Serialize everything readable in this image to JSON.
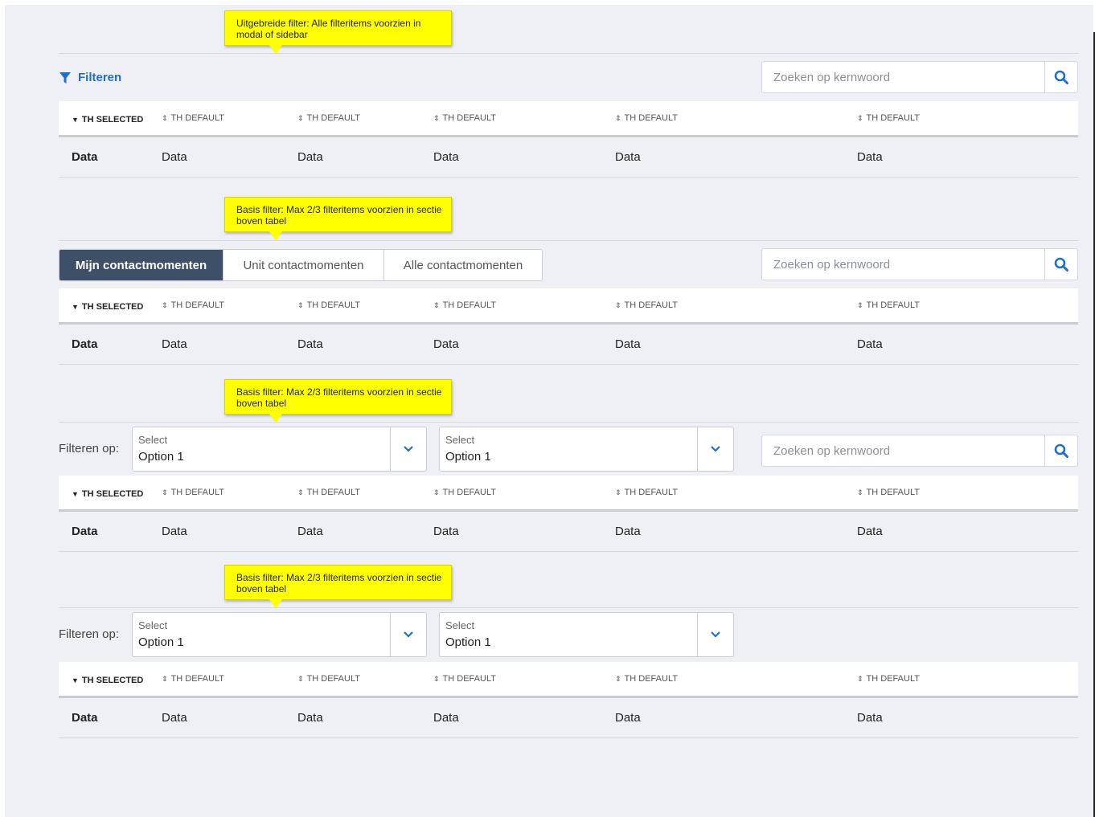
{
  "tooltips": {
    "extended": "Uitgebreide filter: Alle filteritems voorzien in modal of sidebar",
    "basic1": "Basis filter: Max 2/3 filteritems voorzien in sectie boven tabel",
    "basic2": "Basis filter: Max 2/3 filteritems voorzien in sectie boven tabel",
    "basic3": "Basis filter: Max 2/3 filteritems voorzien in sectie boven tabel"
  },
  "filter_link": {
    "label": "Filteren",
    "icon": "funnel-icon"
  },
  "search": {
    "placeholder": "Zoeken op kernwoord",
    "icon": "search-icon"
  },
  "table": {
    "headers": [
      "TH SELECTED",
      "TH DEFAULT",
      "TH DEFAULT",
      "TH DEFAULT",
      "TH DEFAULT",
      "TH DEFAULT"
    ],
    "row": [
      "Data",
      "Data",
      "Data",
      "Data",
      "Data",
      "Data"
    ]
  },
  "segmented": {
    "options": [
      "Mijn contactmomenten",
      "Unit contactmomenten",
      "Alle contactmomenten"
    ],
    "active_index": 0
  },
  "filter_select": {
    "label": "Filteren op:",
    "select1": {
      "label": "Select",
      "value": "Option 1"
    },
    "select2": {
      "label": "Select",
      "value": "Option 1"
    }
  },
  "colors": {
    "accent": "#1f6fc5",
    "active_segment": "#3e5068",
    "tooltip": "#ffff00",
    "background": "#eef0f5"
  }
}
